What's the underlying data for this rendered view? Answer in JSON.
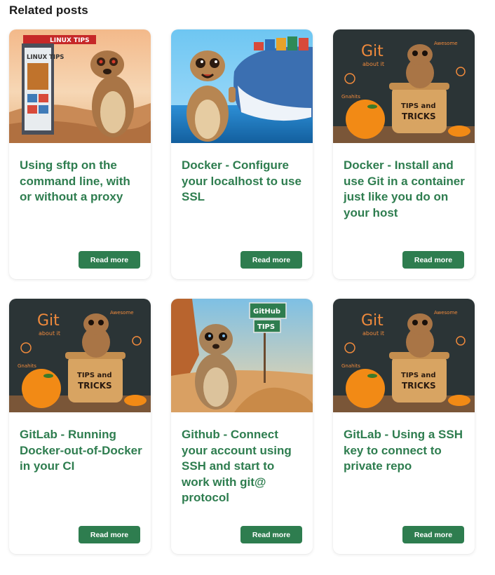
{
  "section": {
    "title": "Related posts"
  },
  "colors": {
    "accent": "#2e7d4f",
    "title_text": "#1a1a1a"
  },
  "posts": [
    {
      "title": "Using sftp on the command line, with or without a proxy",
      "read_more": "Read more",
      "image": {
        "subject": "meerkat next to a signpost",
        "sign_text": "LINUX TIPS",
        "poster_text": "LINUX TIPS"
      }
    },
    {
      "title": "Docker - Configure your localhost to use SSL",
      "read_more": "Read more",
      "image": {
        "subject": "meerkat giving thumbs up in front of a whale carrying containers"
      }
    },
    {
      "title": "Docker - Install and use Git in a container just like you do on your host",
      "read_more": "Read more",
      "image": {
        "subject": "meerkat in a jar with oranges",
        "board_text": "Git",
        "board_subtext": "about it",
        "jar_text": "TIPS and TRICKS"
      }
    },
    {
      "title": "GitLab - Running Docker-out-of-Docker in your CI",
      "read_more": "Read more",
      "image": {
        "subject": "meerkat in a jar with oranges",
        "board_text": "Git",
        "board_subtext": "about it",
        "jar_text": "TIPS and TRICKS"
      }
    },
    {
      "title": "Github - Connect your account using SSH and start to work with git@ protocol",
      "read_more": "Read more",
      "image": {
        "subject": "meerkat in a desert with a signpost",
        "sign_text": "GitHub TIPS"
      }
    },
    {
      "title": "GitLab - Using a SSH key to connect to private repo",
      "read_more": "Read more",
      "image": {
        "subject": "meerkat in a jar with oranges",
        "board_text": "Git",
        "board_subtext": "about it",
        "jar_text": "TIPS and TRICKS"
      }
    }
  ]
}
